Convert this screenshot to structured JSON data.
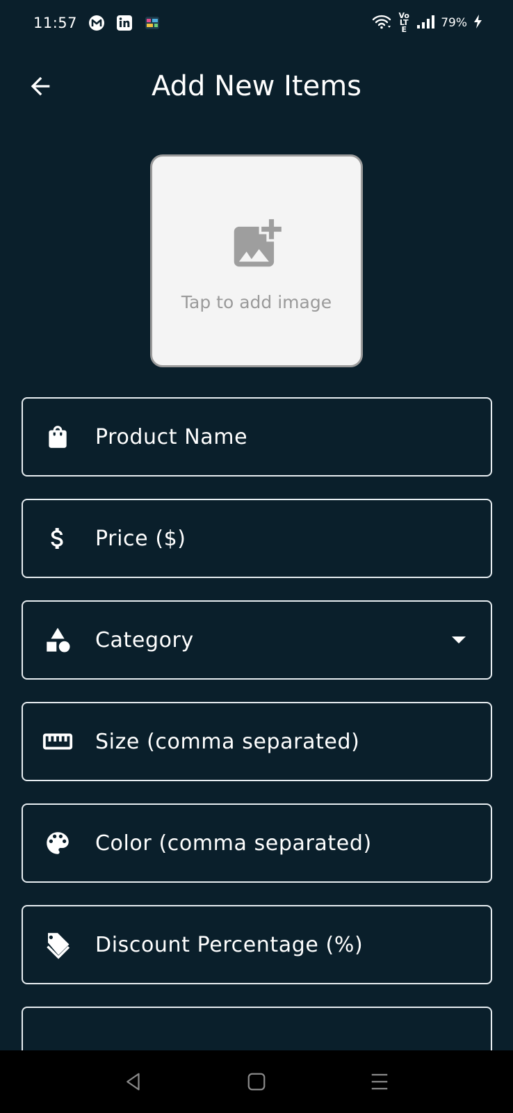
{
  "status_bar": {
    "time": "11:57",
    "battery_percent": "79%",
    "network": "Vo LTE",
    "icons": [
      "gmail-icon",
      "linkedin-icon",
      "app-icon",
      "wifi-icon",
      "volte-icon",
      "signal-icon",
      "battery-charging-icon"
    ]
  },
  "app_bar": {
    "title": "Add New Items",
    "back_icon": "arrow-left-icon"
  },
  "image_picker": {
    "label": "Tap to add image",
    "icon": "add-photo-icon"
  },
  "form": {
    "product_name": {
      "placeholder": "Product Name",
      "icon": "shopping-bag-icon"
    },
    "price": {
      "placeholder": "Price ($)",
      "icon": "dollar-icon"
    },
    "category": {
      "placeholder": "Category",
      "icon": "category-shapes-icon"
    },
    "size": {
      "placeholder": "Size (comma separated)",
      "icon": "ruler-icon"
    },
    "color": {
      "placeholder": "Color (comma separated)",
      "icon": "palette-icon"
    },
    "discount": {
      "placeholder": "Discount Percentage (%)",
      "icon": "tag-icon"
    }
  },
  "colors": {
    "background": "#0a1f2b",
    "field_border": "#e8eef2",
    "picker_bg": "#f4f4f4",
    "picker_text": "#9a9a9a"
  }
}
